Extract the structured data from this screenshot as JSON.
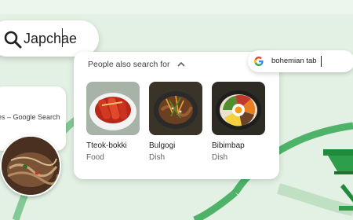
{
  "main_search": {
    "query": "Japchae",
    "icon": "search-icon"
  },
  "left_card": {
    "snippet": "oes – Google Search"
  },
  "panel": {
    "heading": "People also search for",
    "items": [
      {
        "name": "Tteok-bokki",
        "kind": "Food"
      },
      {
        "name": "Bulgogi",
        "kind": "Dish"
      },
      {
        "name": "Bibimbap",
        "kind": "Dish"
      }
    ]
  },
  "mini_search": {
    "query": "bohemian tab"
  },
  "colors": {
    "background": "#e3f1e4",
    "accent_green": "#34a853"
  }
}
